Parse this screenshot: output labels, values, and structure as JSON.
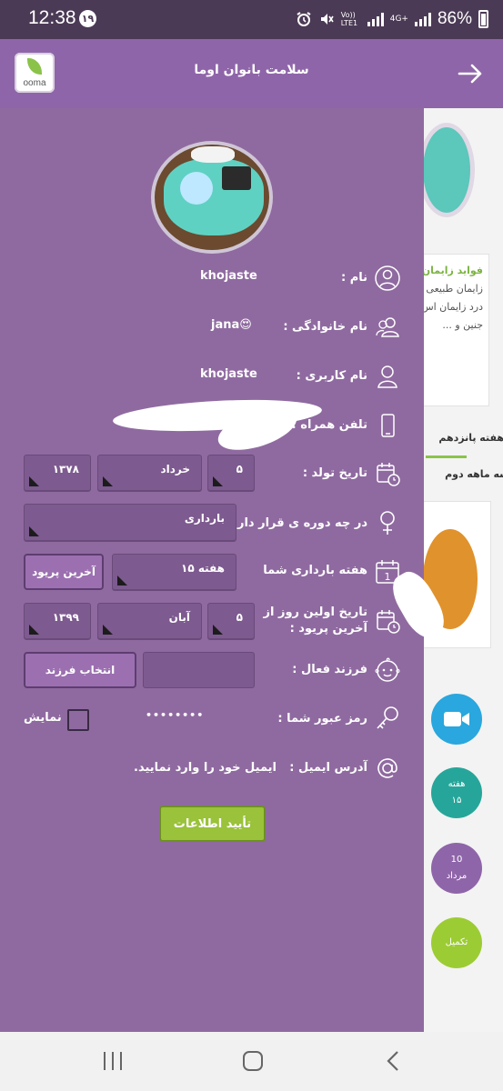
{
  "status_bar": {
    "time": "12:38",
    "notification_badge": "۱۹",
    "network": "Vo)) LTE1",
    "data_type": "4G+",
    "battery": "86%"
  },
  "app_bar": {
    "title": "سلامت بانوان اوما",
    "logo_text": "ooma"
  },
  "profile": {
    "name_label": "نام :",
    "name_value": "khojaste",
    "family_label": "نام خانوادگی :",
    "family_value": "jana😍",
    "username_label": "نام کاربری :",
    "username_value": "khojaste",
    "phone_label": "تلفن همراه :",
    "birth_label": "تاریخ تولد :",
    "birth_day": "۵",
    "birth_month": "خرداد",
    "birth_year": "۱۳۷۸",
    "period_label": "در چه دوره ی قرار دارید؟",
    "period_value": "بارداری",
    "pregnancy_week_label": "هفته بارداری شما",
    "pregnancy_week_value": "هفته ۱۵",
    "last_period_button": "آخرین پریود",
    "last_period_label_line1": "تاریخ اولین روز از",
    "last_period_label_line2": "آخرین پریود :",
    "lp_day": "۵",
    "lp_month": "آبان",
    "lp_year": "۱۳۹۹",
    "active_child_label": "فرزند فعال :",
    "choose_child_button": "انتخاب فرزند",
    "password_label": "رمز عبور شما :",
    "password_value": "••••••••",
    "show_label": "نمایش",
    "email_label": "آدرس ایمیل :",
    "email_placeholder": "ایمیل خود را وارد نمایید.",
    "confirm_button": "تأیید اطلاعات"
  },
  "background_page": {
    "card_title": "فواید زایمان",
    "card_line1": "زایمان طبیعی",
    "card_line2": "درد زایمان اس",
    "card_line3": "جنین و ...",
    "week_heading": "هفته پانزدهم",
    "month_heading": "سه ماهه دوم",
    "circle1_line1": "هفته",
    "circle1_line2": "۱۵",
    "circle2_line1": "10",
    "circle2_line2": "مرداد",
    "circle3": "تکمیل"
  },
  "colors": {
    "drawer": "#8f6aa0",
    "app_bar": "#8f65a9",
    "confirm": "#9ac23a"
  }
}
